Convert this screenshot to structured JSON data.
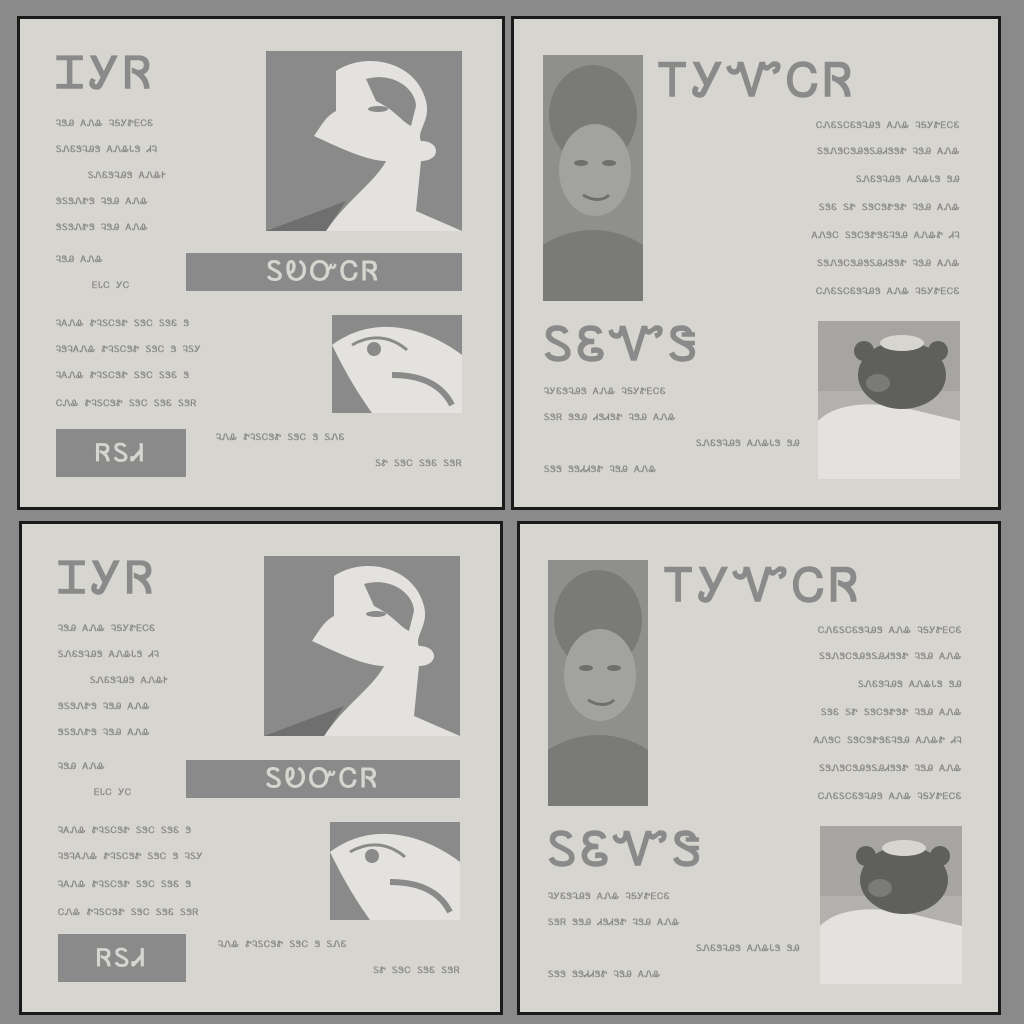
{
  "colors": {
    "background": "#8a8a8a",
    "paper": "#d6d5d0",
    "ink": "#8a8a8a",
    "border": "#1a1a1a"
  },
  "poster_a": {
    "headline": "ᏆᎩᏒ",
    "lines": [
      "ᎸᏕᎯ ᎪᏁᎲ ᎸᎦᎩᏑᎬᏟᏋ",
      "ᏚᏁᏋᏕᎸᎯᏕ ᎪᏁᎲᏓᏕ ᏗᎸ",
      "ᏚᏁᏋᏕᎸᎯᏕ ᎪᏁᎲᎨ",
      "ᏕᏚᏕᏁᏑᏕ ᎸᏕᎯ ᎪᏁᎲ",
      "ᏕᏚᏕᏁᏑᏕ ᎸᏕᎯ ᎪᏁᎲ"
    ],
    "mid_lines": [
      "ᎸᏕᎯ ᎪᏁᎲ",
      "ᎬᏓᏟ ᎩᏟ"
    ],
    "box_title": "ᏚᎧᏅᏟᏒ",
    "lower_lines": [
      "ᎸᎪᏁᎲ ᏑᎸᏚᏟᏕᏑ ᏚᏕᏟ ᏚᏕᏋ Ꮥ",
      "ᎸᏕᎸᎪᏁᎲ ᏑᎸᏚᏟᏕᏑ ᏚᏕᏟ Ꮥ ᎸᏚᎩ",
      "ᎸᎪᏁᎲ ᏑᎸᏚᏟᏕᏑ ᏚᏕᏟ ᏚᏕᏋ Ꮥ",
      "ᏟᏁᎲ ᏑᎸᏚᏟᏕᏑ ᏚᏕᏟ ᏚᏕᏋ ᏚᏕᏒ"
    ],
    "badge": "ᏒᏚᏗ",
    "foot_lines": [
      "ᎸᏁᎲ ᏑᎸᏚᏟᏕᏑ ᏚᏕᏟ Ꮥ ᏚᏁᏋ",
      "ᏚᏑ ᏚᏕᏟ ᏚᏕᏋ ᏚᏕᏒ"
    ]
  },
  "poster_b": {
    "headline": "ᎢᎩᏉᏟᏒ",
    "lines": [
      "ᏟᏁᏋᏚᏟᏋᏕᎸᎯᏕ ᎪᏁᎲ ᎸᎦᎩᏑᎬᏟᏋ",
      "ᏚᏕᏁᏕᏟᏕᎯᏕᏚᎯᏗᏕᏕᏑ ᎸᏕᎯ ᎪᏁᎲ",
      "ᏚᏁᏋᏕᎸᎯᏕ ᎪᏁᎲᏓᏕ ᏕᎯ",
      "ᏚᏕᏋ ᏚᏑ ᏚᏕᏟᏕᏑᏕᏑ ᎸᏕᎯ ᎪᏁᎲ",
      "ᎪᏁᏕᏟ ᏚᏕᏟᏕᏑᏕᏋᎸᏕᎯ ᎪᏁᎲᏑ ᏗᎸ",
      "ᏚᏕᏁᏕᏟᏕᎯᏕᏚᎯᏗᏕᏕᏑ ᎸᏕᎯ ᎪᏁᎲ",
      "ᏟᏁᏋᏚᏟᏋᏕᎸᎯᏕ ᎪᏁᎲ ᎸᎦᎩᏑᎬᏟᏋ"
    ],
    "box_title": "ᏚᏋᏉᏕ",
    "lower_lines": [
      "ᎸᎩᏋᏕᎸᎯᏕ ᎪᏁᎲ ᎸᎦᎩᏑᎬᏟᏋ",
      "ᏚᏕᏒ ᏕᏕᎯ ᏗᏕᏗᏕᏑ ᎸᏕᎯ ᎪᏁᎲ",
      "ᏚᏁᏋᏕᎸᎯᏕ ᎪᏁᎲᏓᏕ ᏕᎯ",
      "ᏚᏕᏕ ᏕᏕᏗᏗᏕᏑ ᎸᏕᎯ ᎪᏁᎲ"
    ]
  }
}
